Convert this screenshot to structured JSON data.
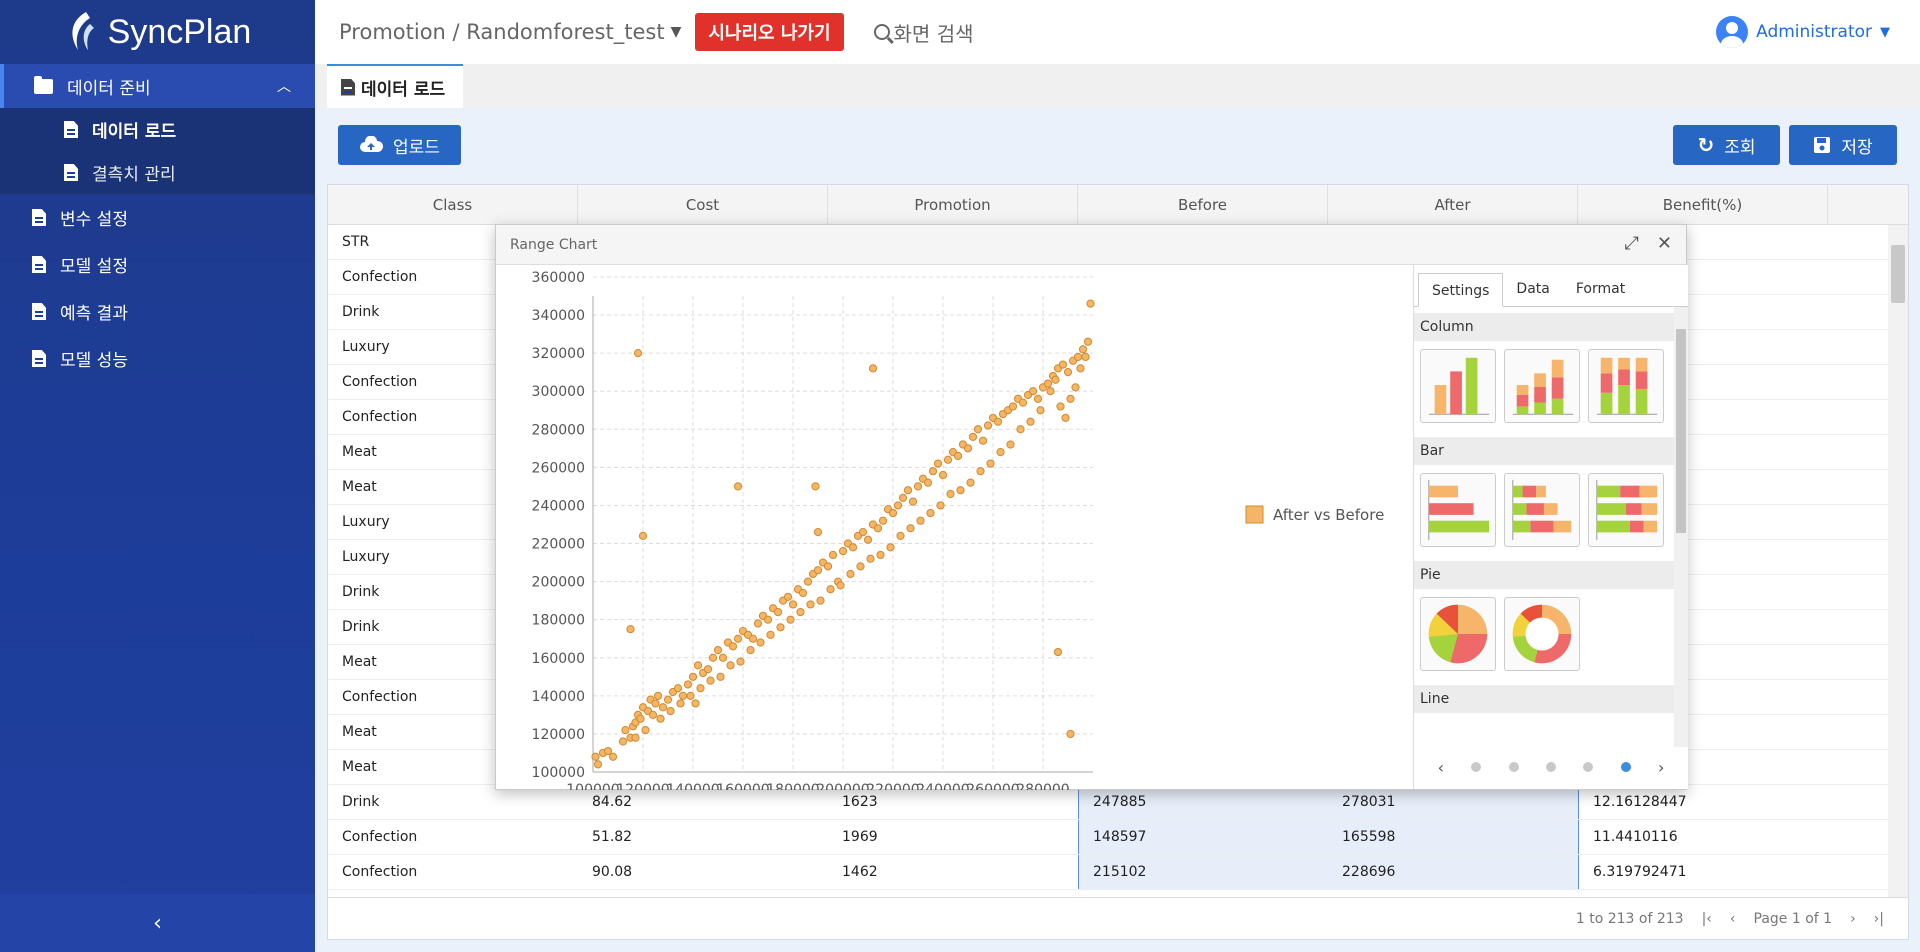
{
  "app": {
    "logo_text": "SyncPlan"
  },
  "sidebar": {
    "group": {
      "label": "데이터 준비",
      "items": [
        {
          "label": "데이터 로드"
        },
        {
          "label": "결측치 관리"
        }
      ]
    },
    "items": [
      {
        "label": "변수 설정"
      },
      {
        "label": "모델 설정"
      },
      {
        "label": "예측 결과"
      },
      {
        "label": "모델 성능"
      }
    ],
    "collapse_icon": "chevron-left-icon"
  },
  "header": {
    "breadcrumb": "Promotion / Randomforest_test",
    "exit_label": "시나리오 나가기",
    "search_label": "화면 검색",
    "user": "Administrator"
  },
  "tabs": [
    {
      "label": "데이터 로드"
    }
  ],
  "toolbar": {
    "upload_label": "업로드",
    "query_label": "조회",
    "save_label": "저장"
  },
  "grid": {
    "columns": [
      "Class",
      "Cost",
      "Promotion",
      "Before",
      "After",
      "Benefit(%)"
    ],
    "rows": [
      [
        "STR",
        "",
        "",
        "",
        "",
        ""
      ],
      [
        "Confection",
        "",
        "",
        "",
        "",
        ""
      ],
      [
        "Drink",
        "",
        "",
        "",
        "",
        ""
      ],
      [
        "Luxury",
        "",
        "",
        "",
        "",
        ""
      ],
      [
        "Confection",
        "",
        "",
        "",
        "",
        ""
      ],
      [
        "Confection",
        "",
        "",
        "",
        "",
        ""
      ],
      [
        "Meat",
        "",
        "",
        "",
        "",
        ""
      ],
      [
        "Meat",
        "",
        "",
        "",
        "",
        ""
      ],
      [
        "Luxury",
        "",
        "",
        "",
        "",
        ""
      ],
      [
        "Luxury",
        "",
        "",
        "",
        "",
        ""
      ],
      [
        "Drink",
        "",
        "",
        "",
        "",
        ""
      ],
      [
        "Drink",
        "",
        "",
        "",
        "",
        ""
      ],
      [
        "Meat",
        "",
        "",
        "",
        "",
        ""
      ],
      [
        "Confection",
        "",
        "",
        "",
        "",
        ""
      ],
      [
        "Meat",
        "",
        "",
        "",
        "",
        ""
      ],
      [
        "Meat",
        "",
        "",
        "",
        "",
        ""
      ],
      [
        "Drink",
        "84.62",
        "1623",
        "247885",
        "278031",
        "12.16128447"
      ],
      [
        "Confection",
        "51.82",
        "1969",
        "148597",
        "165598",
        "11.4410116"
      ],
      [
        "Confection",
        "90.08",
        "1462",
        "215102",
        "228696",
        "6.319792471"
      ]
    ],
    "footer_range": "1 to 213 of 213",
    "footer_page": "Page 1 of 1"
  },
  "dialog": {
    "title": "Range Chart",
    "panel_tabs": [
      "Settings",
      "Data",
      "Format"
    ],
    "sections": [
      "Column",
      "Bar",
      "Pie",
      "Line"
    ]
  },
  "chart_data": {
    "type": "scatter",
    "series": [
      {
        "name": "After vs Before",
        "color": "#f4b566"
      }
    ],
    "xlim": [
      100000,
      300000
    ],
    "ylim": [
      100000,
      350000
    ],
    "x_ticks": [
      "100000",
      "120000",
      "140000",
      "160000",
      "180000",
      "200000",
      "220000",
      "240000",
      "260000",
      "280000"
    ],
    "y_ticks": [
      "100000",
      "120000",
      "140000",
      "160000",
      "180000",
      "200000",
      "220000",
      "240000",
      "260000",
      "280000",
      "300000",
      "320000",
      "340000",
      "360000"
    ],
    "grid": true,
    "legend": "right",
    "points": [
      [
        101000,
        108000
      ],
      [
        102000,
        104000
      ],
      [
        104000,
        110000
      ],
      [
        106000,
        111000
      ],
      [
        108000,
        108000
      ],
      [
        112000,
        116000
      ],
      [
        113000,
        122000
      ],
      [
        115000,
        118000
      ],
      [
        116000,
        124000
      ],
      [
        117000,
        126000
      ],
      [
        118000,
        130000
      ],
      [
        119000,
        128000
      ],
      [
        120000,
        134000
      ],
      [
        122000,
        132000
      ],
      [
        123000,
        138000
      ],
      [
        124000,
        130000
      ],
      [
        125000,
        136000
      ],
      [
        126000,
        140000
      ],
      [
        128000,
        134000
      ],
      [
        130000,
        138000
      ],
      [
        132000,
        142000
      ],
      [
        134000,
        144000
      ],
      [
        136000,
        140000
      ],
      [
        138000,
        146000
      ],
      [
        140000,
        150000
      ],
      [
        141000,
        136000
      ],
      [
        142000,
        156000
      ],
      [
        144000,
        152000
      ],
      [
        146000,
        154000
      ],
      [
        148000,
        160000
      ],
      [
        150000,
        164000
      ],
      [
        152000,
        160000
      ],
      [
        154000,
        168000
      ],
      [
        156000,
        166000
      ],
      [
        158000,
        170000
      ],
      [
        160000,
        174000
      ],
      [
        162000,
        172000
      ],
      [
        164000,
        170000
      ],
      [
        166000,
        178000
      ],
      [
        168000,
        182000
      ],
      [
        170000,
        180000
      ],
      [
        172000,
        186000
      ],
      [
        174000,
        184000
      ],
      [
        176000,
        190000
      ],
      [
        178000,
        192000
      ],
      [
        180000,
        188000
      ],
      [
        182000,
        196000
      ],
      [
        184000,
        194000
      ],
      [
        186000,
        200000
      ],
      [
        188000,
        204000
      ],
      [
        190000,
        206000
      ],
      [
        192000,
        210000
      ],
      [
        194000,
        208000
      ],
      [
        196000,
        214000
      ],
      [
        198000,
        200000
      ],
      [
        200000,
        216000
      ],
      [
        202000,
        220000
      ],
      [
        204000,
        218000
      ],
      [
        206000,
        224000
      ],
      [
        208000,
        226000
      ],
      [
        210000,
        222000
      ],
      [
        212000,
        230000
      ],
      [
        214000,
        228000
      ],
      [
        216000,
        232000
      ],
      [
        218000,
        238000
      ],
      [
        220000,
        236000
      ],
      [
        222000,
        240000
      ],
      [
        224000,
        244000
      ],
      [
        226000,
        248000
      ],
      [
        228000,
        242000
      ],
      [
        230000,
        250000
      ],
      [
        232000,
        254000
      ],
      [
        234000,
        252000
      ],
      [
        236000,
        258000
      ],
      [
        238000,
        262000
      ],
      [
        240000,
        256000
      ],
      [
        242000,
        264000
      ],
      [
        244000,
        268000
      ],
      [
        246000,
        266000
      ],
      [
        248000,
        272000
      ],
      [
        250000,
        270000
      ],
      [
        252000,
        276000
      ],
      [
        254000,
        280000
      ],
      [
        256000,
        274000
      ],
      [
        258000,
        282000
      ],
      [
        260000,
        286000
      ],
      [
        262000,
        284000
      ],
      [
        264000,
        288000
      ],
      [
        266000,
        290000
      ],
      [
        268000,
        292000
      ],
      [
        270000,
        296000
      ],
      [
        272000,
        294000
      ],
      [
        274000,
        298000
      ],
      [
        276000,
        300000
      ],
      [
        278000,
        296000
      ],
      [
        280000,
        302000
      ],
      [
        282000,
        304000
      ],
      [
        284000,
        308000
      ],
      [
        286000,
        312000
      ],
      [
        288000,
        314000
      ],
      [
        290000,
        310000
      ],
      [
        292000,
        316000
      ],
      [
        294000,
        318000
      ],
      [
        296000,
        322000
      ],
      [
        298000,
        326000
      ],
      [
        299000,
        346000
      ],
      [
        297000,
        318000
      ],
      [
        295000,
        312000
      ],
      [
        293000,
        302000
      ],
      [
        291000,
        296000
      ],
      [
        289000,
        286000
      ],
      [
        287000,
        292000
      ],
      [
        285000,
        306000
      ],
      [
        283000,
        300000
      ],
      [
        279000,
        290000
      ],
      [
        275000,
        284000
      ],
      [
        271000,
        280000
      ],
      [
        267000,
        272000
      ],
      [
        263000,
        268000
      ],
      [
        259000,
        262000
      ],
      [
        255000,
        258000
      ],
      [
        251000,
        252000
      ],
      [
        247000,
        248000
      ],
      [
        243000,
        246000
      ],
      [
        239000,
        240000
      ],
      [
        235000,
        236000
      ],
      [
        231000,
        232000
      ],
      [
        227000,
        228000
      ],
      [
        223000,
        224000
      ],
      [
        219000,
        218000
      ],
      [
        215000,
        214000
      ],
      [
        211000,
        212000
      ],
      [
        207000,
        208000
      ],
      [
        203000,
        204000
      ],
      [
        199000,
        198000
      ],
      [
        195000,
        196000
      ],
      [
        191000,
        190000
      ],
      [
        187000,
        188000
      ],
      [
        183000,
        184000
      ],
      [
        179000,
        180000
      ],
      [
        175000,
        176000
      ],
      [
        171000,
        172000
      ],
      [
        167000,
        168000
      ],
      [
        163000,
        164000
      ],
      [
        159000,
        158000
      ],
      [
        155000,
        156000
      ],
      [
        151000,
        150000
      ],
      [
        147000,
        148000
      ],
      [
        143000,
        144000
      ],
      [
        139000,
        140000
      ],
      [
        135000,
        136000
      ],
      [
        131000,
        132000
      ],
      [
        127000,
        128000
      ],
      [
        121000,
        122000
      ],
      [
        117000,
        118000
      ],
      [
        118000,
        320000
      ],
      [
        212000,
        312000
      ],
      [
        120000,
        224000
      ],
      [
        158000,
        250000
      ],
      [
        115000,
        175000
      ],
      [
        189000,
        250000
      ],
      [
        190000,
        226000
      ],
      [
        286000,
        163000
      ],
      [
        291000,
        120000
      ]
    ]
  }
}
